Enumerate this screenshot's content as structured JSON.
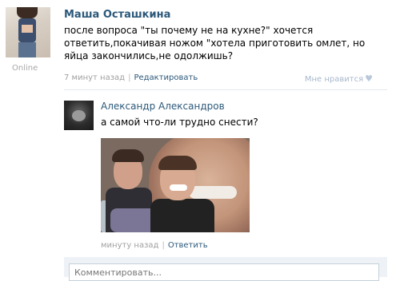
{
  "post": {
    "author": "Маша Осташкина",
    "status": "Online",
    "text_lines": [
      "после вопроса \"ты почему не на кухне?\" хочется",
      "ответить,покачивая ножом \"хотела приготовить омлет, но",
      "яйца закончились,не одолжишь?"
    ],
    "time": "7 минут назад",
    "separator": "|",
    "edit_label": "Редактировать",
    "like_label": "Мне нравится",
    "like_icon": "heart-icon"
  },
  "reply": {
    "author": "Александр Александров",
    "text": "а самой что-ли трудно снести?",
    "time": "минуту назад",
    "separator": "|",
    "answer_label": "Ответить"
  },
  "comment": {
    "placeholder": "Комментировать..."
  },
  "colors": {
    "link": "#2b587a",
    "meta": "#a0a0a0",
    "comment_bg": "#eef2f6"
  }
}
